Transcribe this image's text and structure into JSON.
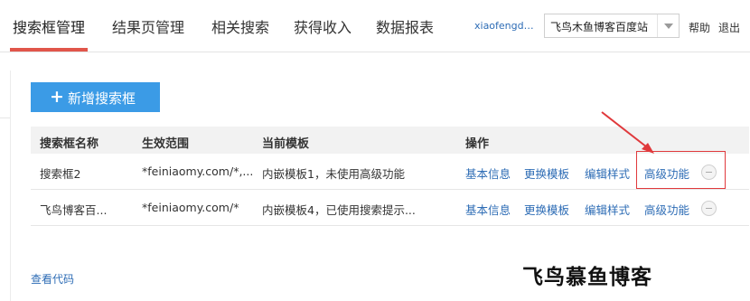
{
  "nav": {
    "tabs": [
      {
        "label": "搜索框管理",
        "active": true
      },
      {
        "label": "结果页管理"
      },
      {
        "label": "相关搜索"
      },
      {
        "label": "获得收入"
      },
      {
        "label": "数据报表"
      }
    ],
    "username": "xiaofengdu...",
    "site_select": {
      "value": "飞鸟木鱼博客百度站"
    },
    "help": "帮助",
    "logout": "退出"
  },
  "main": {
    "add_button": {
      "icon": "plus-icon",
      "label": "新增搜索框"
    },
    "table": {
      "headers": [
        "搜索框名称",
        "生效范围",
        "当前模板",
        "操作"
      ],
      "rows": [
        {
          "name": "搜索框2",
          "scope": "*feiniaomy.com/*,...",
          "template": "内嵌模板1，未使用高级功能",
          "ops": [
            "基本信息",
            "更换模板",
            "编辑样式",
            "高级功能"
          ]
        },
        {
          "name": "飞鸟博客百...",
          "scope": "*feiniaomy.com/*",
          "template": "内嵌模板4，已使用搜索提示...",
          "ops": [
            "基本信息",
            "更换模板",
            "编辑样式",
            "高级功能"
          ]
        }
      ]
    },
    "view_code": "查看代码"
  },
  "watermark": "飞鸟慕鱼博客",
  "colors": {
    "accent": "#3b9be6",
    "link": "#2d6cb5",
    "tab_underline": "#e1554a",
    "annotation_red": "#e0393c"
  }
}
